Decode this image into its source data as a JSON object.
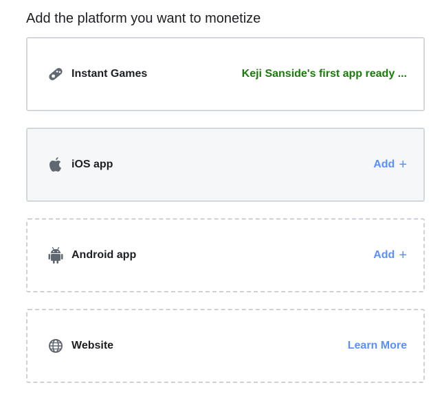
{
  "heading": "Add the platform you want to monetize",
  "colors": {
    "status_green": "#1a7a0c",
    "link_blue": "#5890ff",
    "text_dark": "#1c1e21",
    "icon_grey": "#606770"
  },
  "platforms": [
    {
      "label": "Instant Games",
      "icon": "gamepad-icon",
      "action": "Keji Sanside's first app ready ...",
      "action_type": "status"
    },
    {
      "label": "iOS app",
      "icon": "apple-icon",
      "action": "Add",
      "action_type": "add"
    },
    {
      "label": "Android app",
      "icon": "android-icon",
      "action": "Add",
      "action_type": "add"
    },
    {
      "label": "Website",
      "icon": "globe-icon",
      "action": "Learn More",
      "action_type": "link"
    }
  ],
  "plus_glyph": "+"
}
